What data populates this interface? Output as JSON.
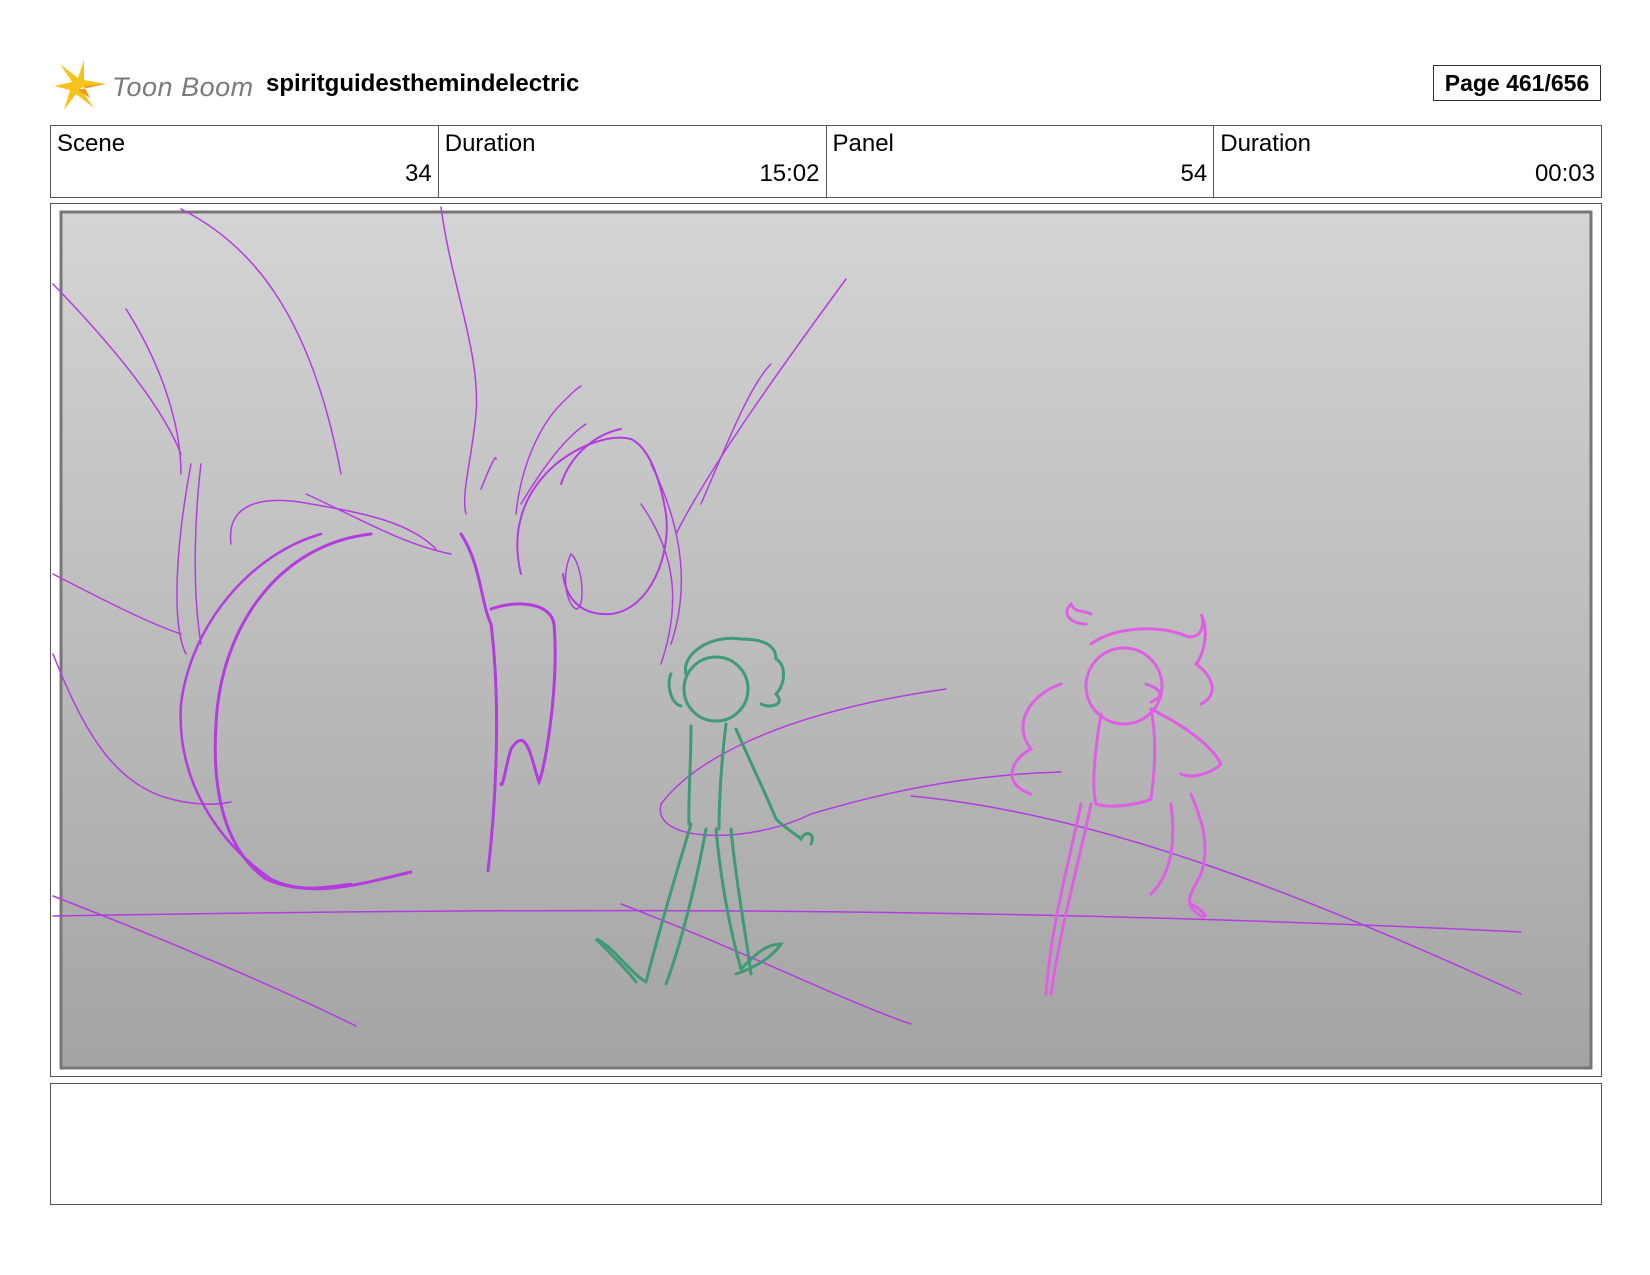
{
  "header": {
    "logo_text": "Toon Boom",
    "project_title": "spiritguidesthemindelectric",
    "page_label": "Page 461/656"
  },
  "info": {
    "scene_label": "Scene",
    "scene_value": "34",
    "scene_duration_label": "Duration",
    "scene_duration_value": "15:02",
    "panel_label": "Panel",
    "panel_value": "54",
    "panel_duration_label": "Duration",
    "panel_duration_value": "00:03"
  },
  "panel": {
    "background_top": "#d4d4d4",
    "background_bottom": "#a4a4a4",
    "creature_color": "#b43be0",
    "left_figure_color": "#3f9a76",
    "right_figure_color": "#e05ee6"
  },
  "notes": {
    "text": ""
  },
  "colors": {
    "logo_yellow": "#f6c21c",
    "logo_orange": "#f39a1b"
  }
}
